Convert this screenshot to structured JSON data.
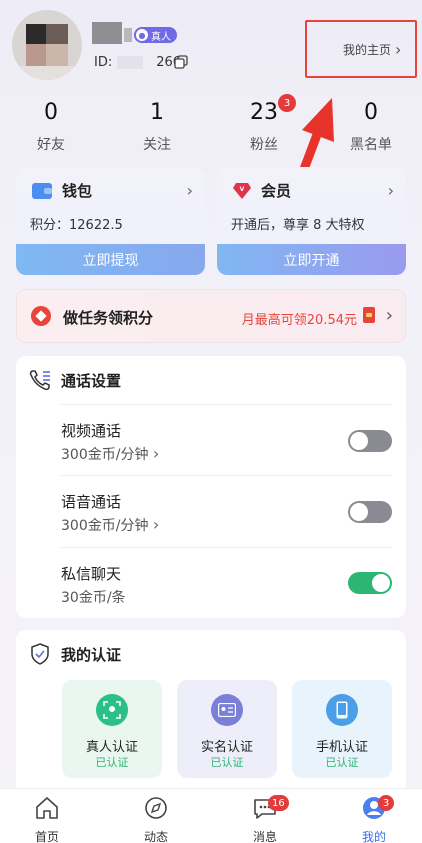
{
  "header": {
    "uid_prefix": "ID:",
    "uid_suffix": "266",
    "real_badge": "真人",
    "home_link": "我的主页",
    "home_chevron": "›"
  },
  "stats": [
    {
      "value": "0",
      "label": "好友"
    },
    {
      "value": "1",
      "label": "关注"
    },
    {
      "value": "23",
      "label": "粉丝",
      "badge": "3"
    },
    {
      "value": "0",
      "label": "黑名单"
    }
  ],
  "wallet": {
    "title": "钱包",
    "sub": "积分：12622.5",
    "button": "立即提现"
  },
  "vip": {
    "title": "会员",
    "sub": "开通后，尊享 8 大特权",
    "button": "立即开通"
  },
  "task": {
    "title": "做任务领积分",
    "reward": "月最高可领20.54元"
  },
  "call_settings": {
    "title": "通话设置",
    "rows": [
      {
        "title": "视频通话",
        "price": "300金币/分钟",
        "enabled": false
      },
      {
        "title": "语音通话",
        "price": "300金币/分钟",
        "enabled": false
      },
      {
        "title": "私信聊天",
        "price": "30金币/条",
        "enabled": true
      }
    ]
  },
  "verification": {
    "title": "我的认证",
    "items": [
      {
        "title": "真人认证",
        "status": "已认证",
        "color": "#2bb673",
        "bg": "#eaf7f0",
        "icon": "face-scan-icon"
      },
      {
        "title": "实名认证",
        "status": "已认证",
        "color": "#7a7fd8",
        "bg": "#eeeefb",
        "icon": "id-card-icon"
      },
      {
        "title": "手机认证",
        "status": "已认证",
        "color": "#4a9fe8",
        "bg": "#e9f3fc",
        "icon": "phone-icon"
      }
    ]
  },
  "tabs": [
    {
      "label": "首页",
      "icon": "home-icon"
    },
    {
      "label": "动态",
      "icon": "compass-icon"
    },
    {
      "label": "消息",
      "icon": "chat-icon",
      "badge": "16"
    },
    {
      "label": "我的",
      "icon": "profile-icon",
      "badge": "3",
      "active": true
    }
  ],
  "colors": {
    "accent": "#e8443a",
    "green": "#2bb673",
    "purple": "#6f6be6"
  }
}
